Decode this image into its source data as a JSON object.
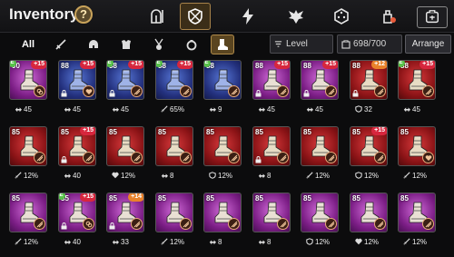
{
  "header": {
    "title": "Inventory",
    "help_label": "?",
    "tabs": [
      {
        "icon": "helmet-sword-icon"
      },
      {
        "icon": "crossed-shield-icon",
        "active": true
      },
      {
        "icon": "lightning-icon"
      },
      {
        "icon": "eagle-crest-icon"
      },
      {
        "icon": "dice-icon"
      },
      {
        "icon": "potion-bag-icon"
      }
    ],
    "bag_icon": "bag-icon"
  },
  "filters": {
    "all_label": "All",
    "tabs": [
      "sword-icon",
      "helmet-icon",
      "chestplate-icon",
      "amulet-icon",
      "ring-icon",
      "boots-icon"
    ],
    "active_index": 6,
    "sort_label": "Level",
    "count_label": "698/700",
    "arrange_label": "Arrange"
  },
  "colors": {
    "purple": "#9b2fa6",
    "blue": "#2c3d9a",
    "red": "#a1171a",
    "plus": "#d7263d",
    "orange_plus": "#e9822a",
    "set": "#e7a97a"
  },
  "items": [
    {
      "level": "90",
      "plus": "+15",
      "rarity": "purple",
      "set": "chain",
      "stat_icon": "arrows-icon",
      "stat": "45",
      "new": true,
      "lock": false
    },
    {
      "level": "88",
      "plus": "+15",
      "rarity": "blue",
      "set": "heart",
      "stat_icon": "arrows-icon",
      "stat": "45",
      "new": false,
      "lock": true
    },
    {
      "level": "88",
      "plus": "+15",
      "rarity": "blue",
      "set": "dash",
      "stat_icon": "arrows-icon",
      "stat": "45",
      "new": true,
      "lock": true
    },
    {
      "level": "88",
      "plus": "+15",
      "rarity": "blue",
      "set": "dash",
      "stat_icon": "dagger-icon",
      "stat": "65%",
      "new": true,
      "lock": false
    },
    {
      "level": "88",
      "plus": "",
      "rarity": "blue",
      "set": "dash",
      "stat_icon": "arrows-icon",
      "stat": "9",
      "new": true,
      "lock": false
    },
    {
      "level": "88",
      "plus": "+15",
      "rarity": "purple",
      "set": "dash",
      "stat_icon": "arrows-icon",
      "stat": "45",
      "new": false,
      "lock": true
    },
    {
      "level": "88",
      "plus": "+15",
      "rarity": "purple",
      "set": "dash",
      "stat_icon": "arrows-icon",
      "stat": "45",
      "new": false,
      "lock": true
    },
    {
      "level": "88",
      "plus": "+12",
      "rarity": "red",
      "set": "dash",
      "stat_icon": "shield-icon",
      "stat": "32",
      "new": false,
      "lock": true
    },
    {
      "level": "88",
      "plus": "+15",
      "rarity": "red",
      "set": "dash",
      "stat_icon": "arrows-icon",
      "stat": "45",
      "new": true,
      "lock": false
    },
    {
      "level": "85",
      "plus": "",
      "rarity": "red",
      "set": "dash",
      "stat_icon": "dagger-icon",
      "stat": "12%",
      "new": false,
      "lock": false
    },
    {
      "level": "85",
      "plus": "+15",
      "rarity": "red",
      "set": "dash",
      "stat_icon": "arrows-icon",
      "stat": "40",
      "new": false,
      "lock": true
    },
    {
      "level": "85",
      "plus": "",
      "rarity": "red",
      "set": "dash",
      "stat_icon": "heart-icon",
      "stat": "12%",
      "new": false,
      "lock": false
    },
    {
      "level": "85",
      "plus": "",
      "rarity": "red",
      "set": "dash",
      "stat_icon": "arrows-icon",
      "stat": "8",
      "new": false,
      "lock": false
    },
    {
      "level": "85",
      "plus": "",
      "rarity": "red",
      "set": "dash",
      "stat_icon": "shield-icon",
      "stat": "12%",
      "new": false,
      "lock": false
    },
    {
      "level": "85",
      "plus": "",
      "rarity": "red",
      "set": "dash",
      "stat_icon": "arrows-icon",
      "stat": "8",
      "new": false,
      "lock": true
    },
    {
      "level": "85",
      "plus": "",
      "rarity": "red",
      "set": "dash",
      "stat_icon": "dagger-icon",
      "stat": "12%",
      "new": false,
      "lock": false
    },
    {
      "level": "85",
      "plus": "+15",
      "rarity": "red",
      "set": "dash",
      "stat_icon": "shield-icon",
      "stat": "12%",
      "new": false,
      "lock": false
    },
    {
      "level": "85",
      "plus": "",
      "rarity": "red",
      "set": "heart",
      "stat_icon": "dagger-icon",
      "stat": "12%",
      "new": false,
      "lock": false
    },
    {
      "level": "85",
      "plus": "",
      "rarity": "purple",
      "set": "dash",
      "stat_icon": "dagger-icon",
      "stat": "12%",
      "new": false,
      "lock": false
    },
    {
      "level": "85",
      "plus": "+15",
      "rarity": "purple",
      "set": "chain",
      "stat_icon": "arrows-icon",
      "stat": "40",
      "new": true,
      "lock": true
    },
    {
      "level": "85",
      "plus": "+14",
      "rarity": "purple",
      "set": "dash",
      "stat_icon": "arrows-icon",
      "stat": "33",
      "new": false,
      "lock": true
    },
    {
      "level": "85",
      "plus": "",
      "rarity": "purple",
      "set": "dash",
      "stat_icon": "dagger-icon",
      "stat": "12%",
      "new": false,
      "lock": false
    },
    {
      "level": "85",
      "plus": "",
      "rarity": "purple",
      "set": "dash",
      "stat_icon": "arrows-icon",
      "stat": "8",
      "new": false,
      "lock": false
    },
    {
      "level": "85",
      "plus": "",
      "rarity": "purple",
      "set": "dash",
      "stat_icon": "arrows-icon",
      "stat": "8",
      "new": false,
      "lock": false
    },
    {
      "level": "85",
      "plus": "",
      "rarity": "purple",
      "set": "dash",
      "stat_icon": "shield-icon",
      "stat": "12%",
      "new": false,
      "lock": false
    },
    {
      "level": "85",
      "plus": "",
      "rarity": "purple",
      "set": "dash",
      "stat_icon": "heart-icon",
      "stat": "12%",
      "new": false,
      "lock": false
    },
    {
      "level": "85",
      "plus": "",
      "rarity": "purple",
      "set": "dash",
      "stat_icon": "dagger-icon",
      "stat": "12%",
      "new": false,
      "lock": false
    }
  ]
}
